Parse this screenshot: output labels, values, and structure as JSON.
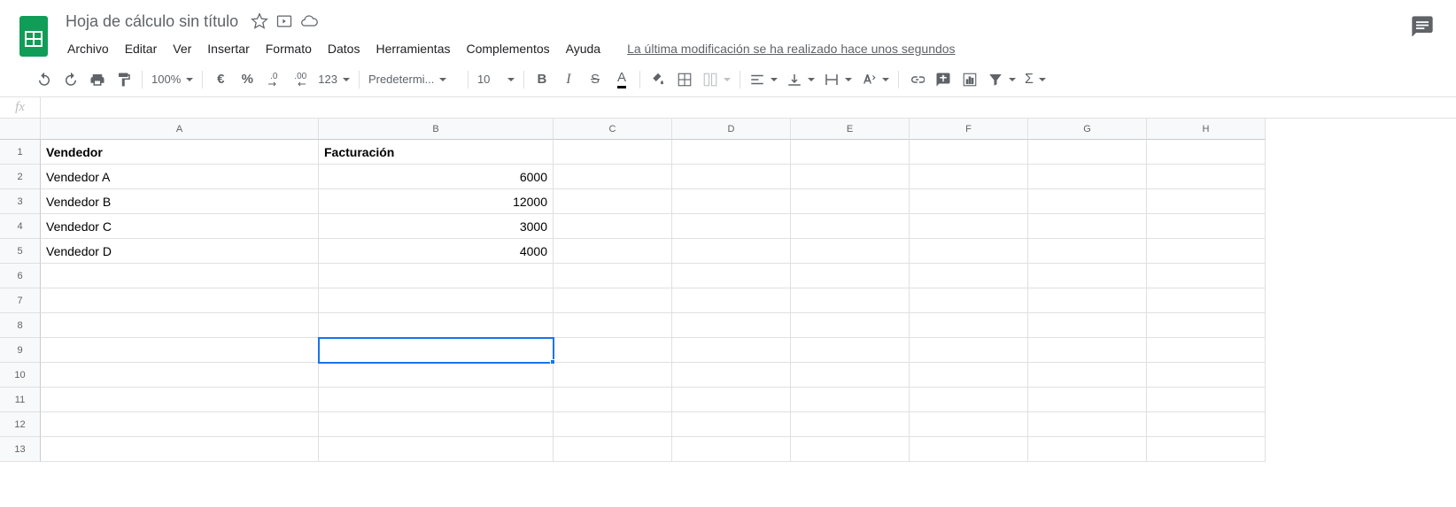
{
  "doc_title": "Hoja de cálculo sin título",
  "menu": [
    "Archivo",
    "Editar",
    "Ver",
    "Insertar",
    "Formato",
    "Datos",
    "Herramientas",
    "Complementos",
    "Ayuda"
  ],
  "last_edit": "La última modificación se ha realizado hace unos segundos",
  "toolbar": {
    "zoom": "100%",
    "currency": "€",
    "percent": "%",
    "dec_less": ".0",
    "dec_more": ".00",
    "format_num": "123",
    "font": "Predetermi...",
    "font_size": "10"
  },
  "columns": [
    "A",
    "B",
    "C",
    "D",
    "E",
    "F",
    "G",
    "H"
  ],
  "col_widths": [
    "a",
    "b",
    "other",
    "other",
    "other",
    "other",
    "other",
    "other"
  ],
  "row_count": 13,
  "selected_cell": {
    "row": 9,
    "col": 1
  },
  "cells": {
    "1": [
      {
        "v": "Vendedor",
        "bold": true
      },
      {
        "v": "Facturación",
        "bold": true
      }
    ],
    "2": [
      {
        "v": "Vendedor A"
      },
      {
        "v": "6000",
        "right": true
      }
    ],
    "3": [
      {
        "v": "Vendedor B"
      },
      {
        "v": "12000",
        "right": true
      }
    ],
    "4": [
      {
        "v": "Vendedor C"
      },
      {
        "v": "3000",
        "right": true
      }
    ],
    "5": [
      {
        "v": "Vendedor D"
      },
      {
        "v": "4000",
        "right": true
      }
    ]
  },
  "chart_data": {
    "type": "table",
    "headers": [
      "Vendedor",
      "Facturación"
    ],
    "rows": [
      [
        "Vendedor A",
        6000
      ],
      [
        "Vendedor B",
        12000
      ],
      [
        "Vendedor C",
        3000
      ],
      [
        "Vendedor D",
        4000
      ]
    ]
  }
}
